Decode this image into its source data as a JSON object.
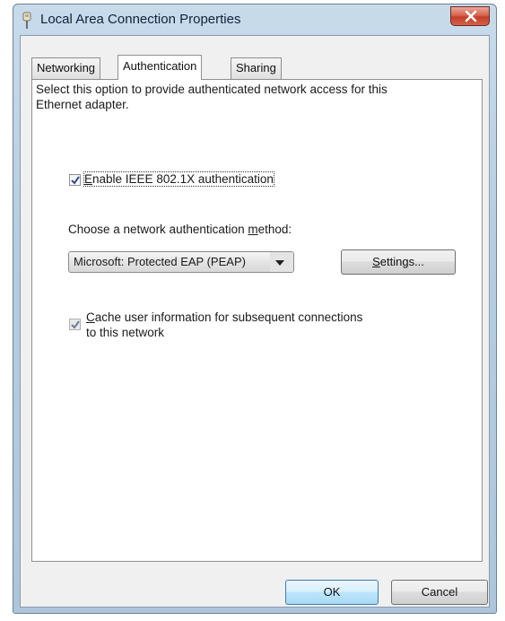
{
  "window": {
    "title": "Local Area Connection Properties"
  },
  "tabs": [
    {
      "label": "Networking"
    },
    {
      "label": "Authentication"
    },
    {
      "label": "Sharing"
    }
  ],
  "auth": {
    "description": "Select this option to provide authenticated network access for this Ethernet adapter.",
    "enable_8021x": {
      "checked": true,
      "label_pre": "",
      "label_key": "E",
      "label_post": "nable IEEE 802.1X authentication"
    },
    "method_label": {
      "pre": "Choose a network authentication ",
      "key": "m",
      "post": "ethod:"
    },
    "method_select": {
      "value": "Microsoft: Protected EAP (PEAP)"
    },
    "settings_button": {
      "key": "S",
      "post": "ettings..."
    },
    "cache_user_info": {
      "checked": true,
      "disabled": true,
      "label_key": "C",
      "label_line1": "ache user information for subsequent connections",
      "label_line2": "to this network"
    }
  },
  "footer": {
    "ok_label": "OK",
    "cancel_label": "Cancel"
  },
  "icons": {
    "title_icon": "network-connection-icon",
    "close_icon": "close-icon",
    "dropdown_icon": "chevron-down-icon",
    "check_icon": "checkmark-icon"
  },
  "colors": {
    "title_bar": "#b6cde1",
    "close_button": "#c3402b",
    "default_button": "#bee6fd"
  }
}
